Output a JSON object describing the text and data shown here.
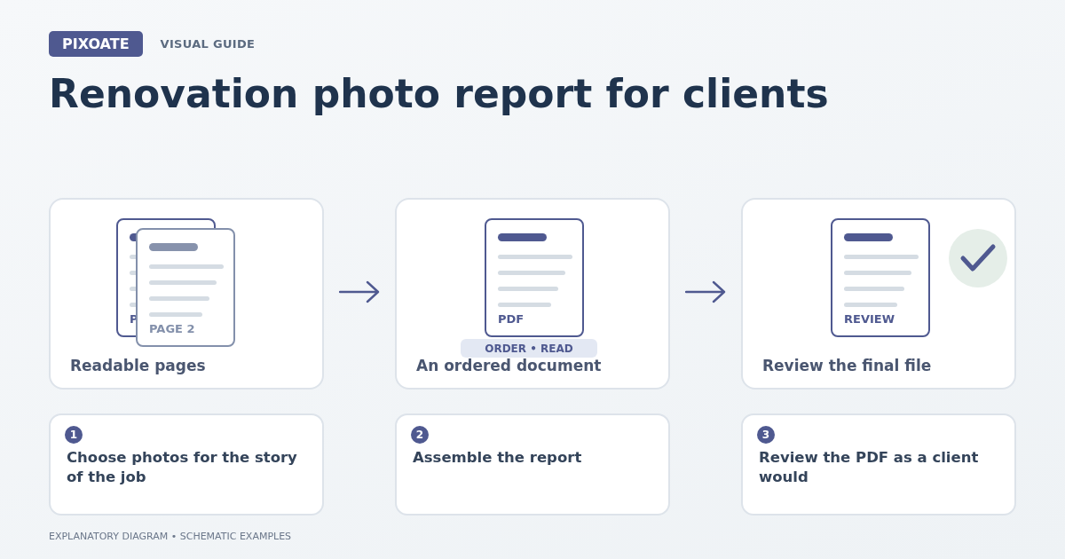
{
  "brand": {
    "badge": "PIXOATE",
    "tag": "VISUAL GUIDE"
  },
  "title": "Renovation photo report for clients",
  "panels": [
    {
      "kind": "pages",
      "back_label": "P",
      "front_label": "PAGE 2",
      "caption": "Readable pages"
    },
    {
      "kind": "document",
      "doc_label": "PDF",
      "pill": "ORDER • READ",
      "caption": "An ordered document"
    },
    {
      "kind": "review",
      "doc_label": "REVIEW",
      "caption": "Review the final file"
    }
  ],
  "steps": [
    {
      "number": "1",
      "text": "Choose photos for the story of the job"
    },
    {
      "number": "2",
      "text": "Assemble the report"
    },
    {
      "number": "3",
      "text": "Review the PDF as a client would"
    }
  ],
  "footer": "EXPLANATORY DIAGRAM • SCHEMATIC EXAMPLES"
}
